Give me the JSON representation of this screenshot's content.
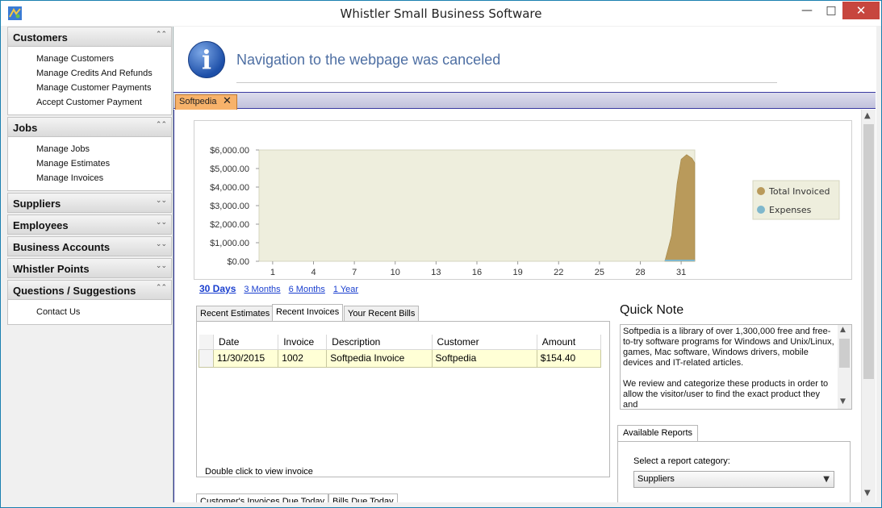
{
  "window": {
    "title": "Whistler Small  Business Software"
  },
  "sidebar": {
    "groups": [
      {
        "title": "Customers",
        "items": [
          "Manage Customers",
          "Manage Credits And Refunds",
          "Manage Customer Payments",
          "Accept Customer Payment"
        ]
      },
      {
        "title": "Jobs",
        "items": [
          "Manage Jobs",
          "Manage Estimates",
          "Manage Invoices"
        ]
      },
      {
        "title": "Suppliers",
        "items": []
      },
      {
        "title": "Employees",
        "items": []
      },
      {
        "title": "Business Accounts",
        "items": []
      },
      {
        "title": "Whistler Points",
        "items": []
      },
      {
        "title": "Questions / Suggestions",
        "items": [
          "Contact Us"
        ]
      }
    ]
  },
  "navigation": {
    "message": "Navigation to the webpage was canceled"
  },
  "doc_tab": {
    "label": "Softpedia",
    "close": "✕"
  },
  "chart_data": {
    "type": "area",
    "x_ticks": [
      "1",
      "4",
      "7",
      "10",
      "13",
      "16",
      "19",
      "22",
      "25",
      "28",
      "31"
    ],
    "y_ticks": [
      "$0.00",
      "$1,000.00",
      "$2,000.00",
      "$3,000.00",
      "$4,000.00",
      "$5,000.00",
      "$6,000.00"
    ],
    "ylim": [
      0,
      6000
    ],
    "xlim": [
      0,
      32
    ],
    "series": [
      {
        "name": "Total Invoiced",
        "color": "#b99a5b",
        "points": [
          [
            29.8,
            0
          ],
          [
            30.3,
            1400
          ],
          [
            30.7,
            4200
          ],
          [
            31.0,
            5500
          ],
          [
            31.4,
            5750
          ],
          [
            31.8,
            5550
          ],
          [
            32.0,
            5300
          ]
        ]
      },
      {
        "name": "Expenses",
        "color": "#7fb7cc",
        "points": [
          [
            29.8,
            0
          ],
          [
            32.0,
            0
          ]
        ]
      }
    ],
    "legend_position": "right",
    "grid": false
  },
  "range_links": [
    {
      "label": "30 Days",
      "active": true
    },
    {
      "label": "3 Months",
      "active": false
    },
    {
      "label": "6 Months",
      "active": false
    },
    {
      "label": "1 Year",
      "active": false
    }
  ],
  "invoice_tabs": [
    "Recent Estimates",
    "Recent Invoices",
    "Your Recent Bills"
  ],
  "invoice_grid": {
    "columns": [
      "Date",
      "Invoice",
      "Description",
      "Customer",
      "Amount"
    ],
    "rows": [
      [
        "11/30/2015",
        "1002",
        "Softpedia Invoice",
        "Softpedia",
        "$154.40"
      ]
    ],
    "hint": "Double click to view invoice"
  },
  "bottom_tabs": [
    "Customer's Invoices Due Today",
    "Bills Due Today"
  ],
  "quick_note": {
    "title": "Quick Note",
    "paragraphs": [
      "Softpedia is a library of over 1,300,000 free and free-to-try software programs for Windows and Unix/Linux, games, Mac software, Windows drivers, mobile devices and IT-related articles.",
      "We review and categorize these products in order to allow the visitor/user to find the exact product they and"
    ]
  },
  "reports": {
    "tab": "Available Reports",
    "label": "Select a report category:",
    "selected": "Suppliers"
  }
}
